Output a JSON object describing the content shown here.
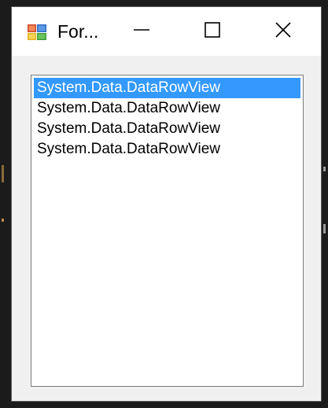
{
  "window": {
    "title": "For..."
  },
  "titlebar": {
    "icons": [
      "app-form-icon",
      "minimize-icon",
      "maximize-icon",
      "close-icon"
    ]
  },
  "listbox": {
    "selected_index": 0,
    "items": [
      {
        "label": "System.Data.DataRowView"
      },
      {
        "label": "System.Data.DataRowView"
      },
      {
        "label": "System.Data.DataRowView"
      },
      {
        "label": "System.Data.DataRowView"
      }
    ]
  },
  "colors": {
    "selection": "#3399ff",
    "window_bg": "#f0f0f0",
    "titlebar_bg": "#ffffff"
  }
}
